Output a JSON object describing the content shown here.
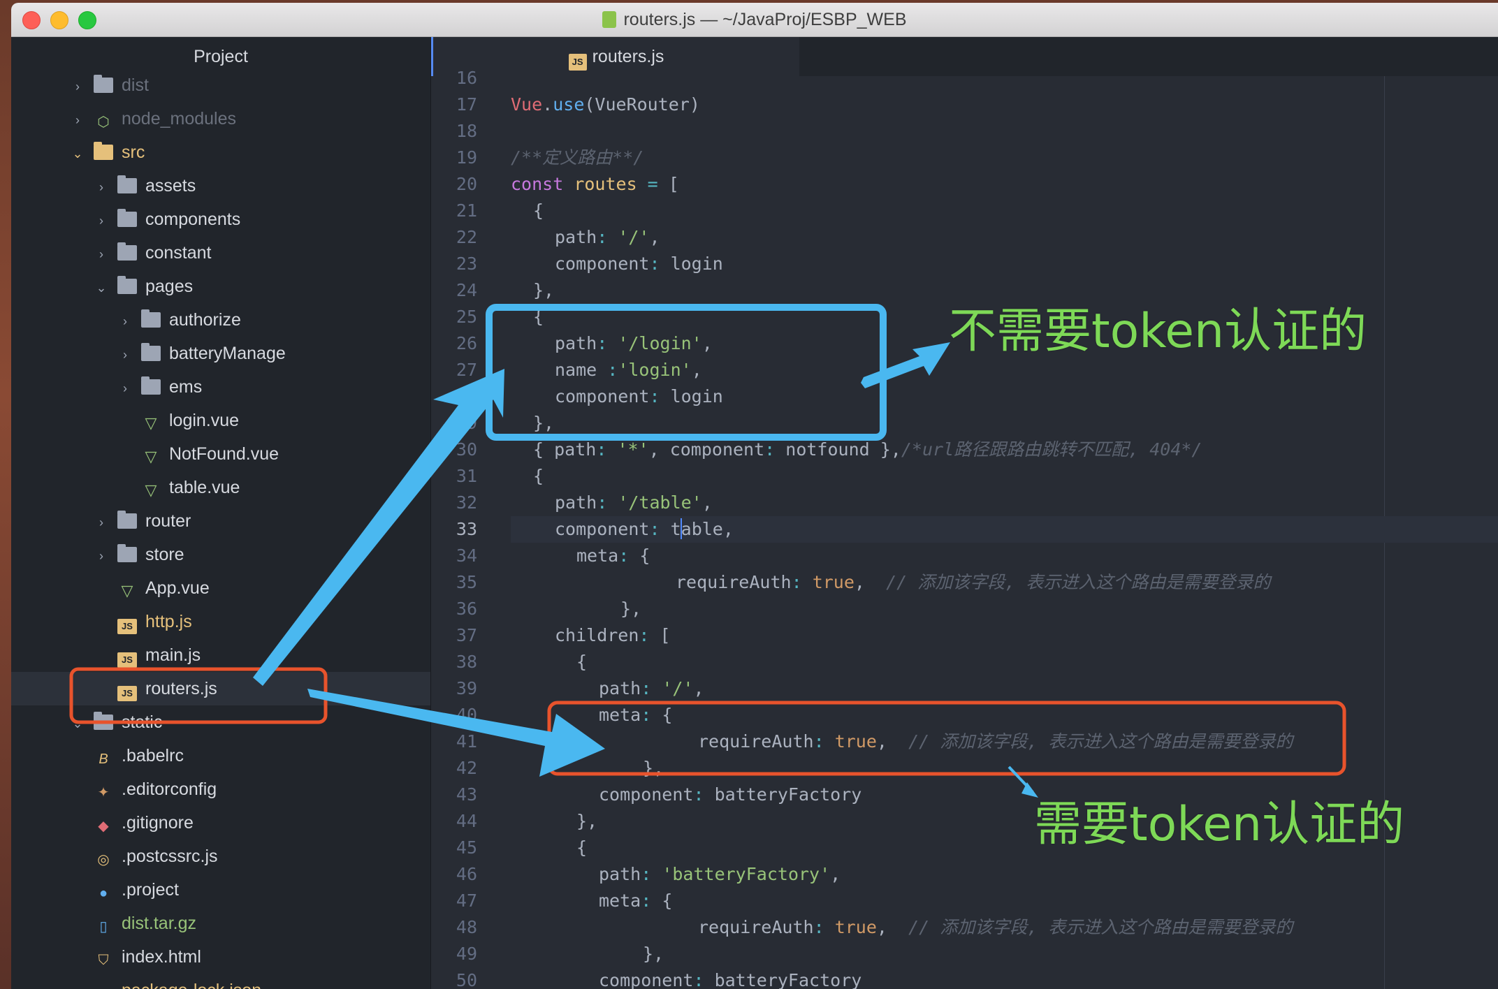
{
  "window": {
    "title": "routers.js — ~/JavaProj/ESBP_WEB"
  },
  "tree": {
    "header": "Project",
    "items": [
      {
        "label": "dist",
        "icon": "folder-icon",
        "chevron": "›"
      },
      {
        "label": "node_modules",
        "icon": "nodejs-icon",
        "chevron": "›"
      },
      {
        "label": "src",
        "icon": "folder-icon",
        "chevron": "⌄"
      },
      {
        "label": "assets",
        "icon": "folder-icon",
        "chevron": "›"
      },
      {
        "label": "components",
        "icon": "folder-icon",
        "chevron": "›"
      },
      {
        "label": "constant",
        "icon": "folder-icon",
        "chevron": "›"
      },
      {
        "label": "pages",
        "icon": "folder-icon",
        "chevron": "⌄"
      },
      {
        "label": "authorize",
        "icon": "folder-icon",
        "chevron": "›"
      },
      {
        "label": "batteryManage",
        "icon": "folder-icon",
        "chevron": "›"
      },
      {
        "label": "ems",
        "icon": "folder-icon",
        "chevron": "›"
      },
      {
        "label": "login.vue",
        "icon": "vue-icon",
        "chevron": ""
      },
      {
        "label": "NotFound.vue",
        "icon": "vue-icon",
        "chevron": ""
      },
      {
        "label": "table.vue",
        "icon": "vue-icon",
        "chevron": ""
      },
      {
        "label": "router",
        "icon": "folder-icon",
        "chevron": "›"
      },
      {
        "label": "store",
        "icon": "folder-icon",
        "chevron": "›"
      },
      {
        "label": "App.vue",
        "icon": "vue-icon",
        "chevron": ""
      },
      {
        "label": "http.js",
        "icon": "js-icon",
        "chevron": ""
      },
      {
        "label": "main.js",
        "icon": "js-icon",
        "chevron": ""
      },
      {
        "label": "routers.js",
        "icon": "js-icon",
        "chevron": ""
      },
      {
        "label": "static",
        "icon": "folder-icon",
        "chevron": "⌄"
      },
      {
        "label": ".babelrc",
        "icon": "babel-icon",
        "chevron": ""
      },
      {
        "label": ".editorconfig",
        "icon": "editorconfig-icon",
        "chevron": ""
      },
      {
        "label": ".gitignore",
        "icon": "git-icon",
        "chevron": ""
      },
      {
        "label": ".postcssrc.js",
        "icon": "postcss-icon",
        "chevron": ""
      },
      {
        "label": ".project",
        "icon": "eclipse-icon",
        "chevron": ""
      },
      {
        "label": "dist.tar.gz",
        "icon": "archive-icon",
        "chevron": ""
      },
      {
        "label": "index.html",
        "icon": "html5-icon",
        "chevron": ""
      },
      {
        "label": "package-lock.json",
        "icon": "npm-icon",
        "chevron": ""
      }
    ],
    "js_badge": "JS"
  },
  "editor": {
    "tab_label": "routers.js",
    "tab_badge": "JS",
    "line_numbers": [
      "16",
      "17",
      "18",
      "19",
      "20",
      "21",
      "22",
      "23",
      "24",
      "25",
      "26",
      "27",
      "28",
      "29",
      "30",
      "31",
      "32",
      "33",
      "34",
      "35",
      "36",
      "37",
      "38",
      "39",
      "40",
      "41",
      "42",
      "43",
      "44",
      "45",
      "46",
      "47",
      "48",
      "49",
      "50"
    ],
    "code": {
      "l17_a": "Vue",
      "l17_b": ".",
      "l17_c": "use",
      "l17_d": "(VueRouter)",
      "l19": "/**定义路由**/",
      "l20_a": "const",
      "l20_b": " routes",
      "l20_c": " = ",
      "l20_d": "[",
      "open_brace": "{",
      "path_key": "path",
      "component_key": "component",
      "name_key": "name",
      "colon": ": ",
      "comma": ",",
      "close_brace_comma": "},",
      "str_root": "'/'",
      "str_login": "'/login'",
      "str_login_name": "'login'",
      "name_colon": " :",
      "login": "login",
      "l30_a": "{ ",
      "str_star": "'*'",
      "notfound": "notfound",
      "l30_close": " },",
      "l30_comment": "/*url路径跟路由跳转不匹配, 404*/",
      "str_table": "'/table'",
      "table_a": "t",
      "table_b": "able,",
      "meta_key": "meta",
      "meta_open": "{",
      "require_key": "requireAuth",
      "true_val": "true",
      "require_comment": "// 添加该字段, 表示进入这个路由是需要登录的",
      "children_key": "children",
      "children_open": "[",
      "battery_factory": "batteryFactory",
      "str_battery": "'batteryFactory'"
    }
  },
  "annotations": {
    "no_token": "不需要token认证的",
    "need_token": "需要token认证的",
    "arrow_color": "#4ab8f0",
    "box_blue": "#4ab8f0",
    "box_red": "#e8532c",
    "text_green": "#7ed957"
  }
}
